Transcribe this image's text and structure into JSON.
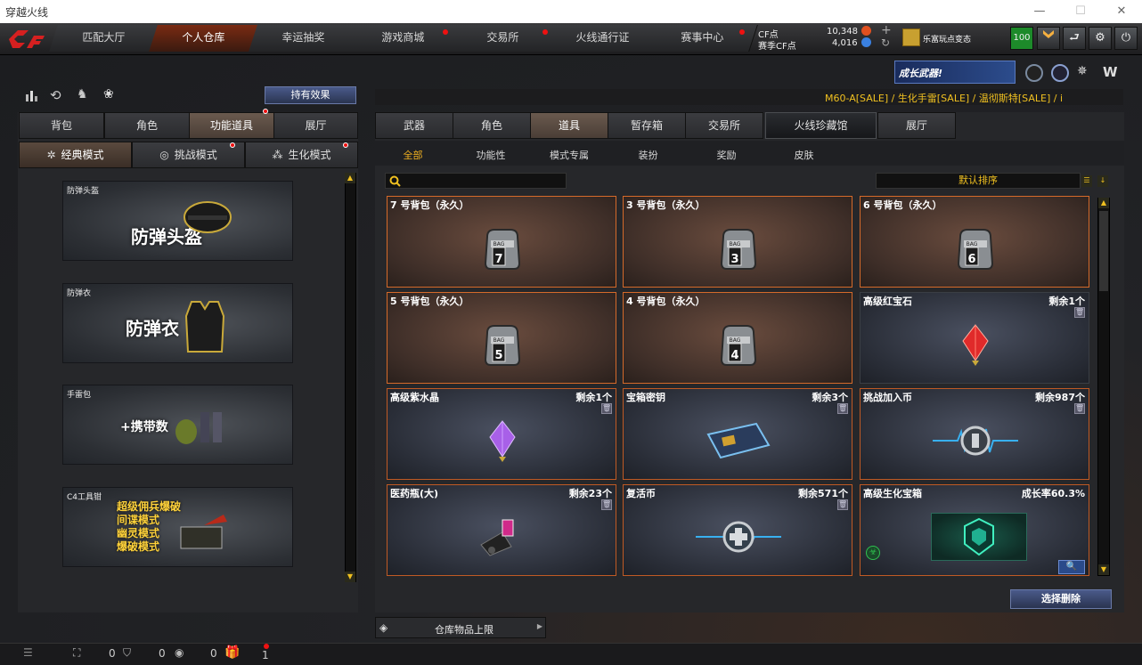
{
  "window": {
    "title": "穿越火线",
    "minimize": "—",
    "maximize": "☐",
    "close": "✕"
  },
  "nav": {
    "tabs": [
      "匹配大厅",
      "个人仓库",
      "幸运抽奖",
      "游戏商城",
      "交易所",
      "火线通行证",
      "赛事中心"
    ],
    "active": 1,
    "cf_label": "CF点",
    "cf_value": "10,348",
    "match_cf_label": "赛季CF点",
    "match_cf_value": "4,016",
    "lequ_label": "乐富玩点变态",
    "level": "100"
  },
  "left": {
    "effects_button": "持有效果",
    "tabs": [
      "背包",
      "角色",
      "功能道具",
      "展厅"
    ],
    "active_tab": 2,
    "modes": [
      "经典模式",
      "挑战模式",
      "生化模式"
    ],
    "cards": [
      {
        "caption": "防弹头盔",
        "title": "防弹头盔"
      },
      {
        "caption": "防弹衣",
        "title": "防弹衣"
      },
      {
        "caption": "手雷包",
        "title": "+携带数"
      },
      {
        "caption": "C4工具钳",
        "lines": [
          "超级佣兵爆破",
          "间谍模式",
          "幽灵模式",
          "爆破模式"
        ]
      }
    ]
  },
  "right": {
    "banner": "成长武器!",
    "ticker": "M60-A[SALE] / 生化手雷[SALE] / 温彻斯特[SALE] / i",
    "tabs": [
      "武器",
      "角色",
      "道具",
      "暂存箱",
      "交易所",
      "火线珍藏馆",
      "展厅"
    ],
    "active_tab": 2,
    "subtabs": [
      "全部",
      "功能性",
      "模式专属",
      "装扮",
      "奖励",
      "皮肤"
    ],
    "active_subtab": 0,
    "search_placeholder": "",
    "sort": "默认排序",
    "items": [
      {
        "name": "7 号背包（永久）",
        "remain": "",
        "bag": "7",
        "type": "bag"
      },
      {
        "name": "3 号背包（永久）",
        "remain": "",
        "bag": "3",
        "type": "bag"
      },
      {
        "name": "6 号背包（永久）",
        "remain": "",
        "bag": "6",
        "type": "bag"
      },
      {
        "name": "5 号背包（永久）",
        "remain": "",
        "bag": "5",
        "type": "bag"
      },
      {
        "name": "4 号背包（永久）",
        "remain": "",
        "bag": "4",
        "type": "bag"
      },
      {
        "name": "高级红宝石",
        "remain": "剩余1个",
        "type": "ruby"
      },
      {
        "name": "高级紫水晶",
        "remain": "剩余1个",
        "type": "amethyst"
      },
      {
        "name": "宝箱密钥",
        "remain": "剩余3个",
        "type": "key"
      },
      {
        "name": "挑战加入币",
        "remain": "剩余987个",
        "type": "coin"
      },
      {
        "name": "医药瓶(大)",
        "remain": "剩余23个",
        "type": "medkit"
      },
      {
        "name": "复活币",
        "remain": "剩余571个",
        "type": "revive"
      },
      {
        "name": "高级生化宝箱",
        "remain": "成长率60.3%",
        "type": "chest"
      }
    ],
    "select_delete": "选择删除",
    "capacity_label": "仓库物品上限"
  },
  "status": {
    "count1": "0",
    "count2": "0",
    "count3": "0",
    "count4": "1"
  }
}
